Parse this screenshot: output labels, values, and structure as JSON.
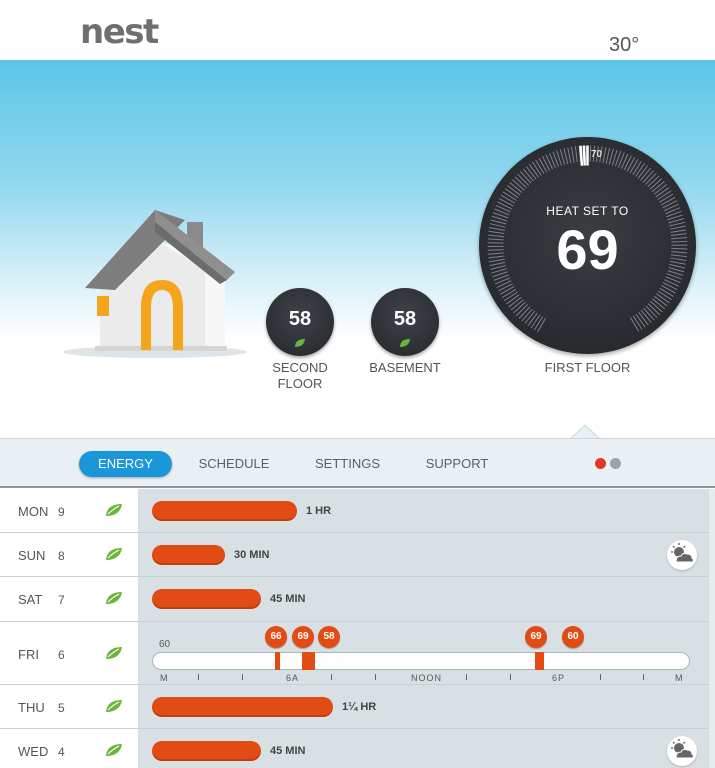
{
  "header": {
    "logo": "nest",
    "outside_temp": "30°"
  },
  "hero": {
    "small_thermostats": [
      {
        "value": "58",
        "label_line1": "SECOND",
        "label_line2": "FLOOR"
      },
      {
        "value": "58",
        "label_line1": "BASEMENT",
        "label_line2": ""
      }
    ],
    "main_thermostat": {
      "mode_label": "HEAT SET TO",
      "value": "69",
      "dial_marker": "70",
      "label": "FIRST FLOOR"
    }
  },
  "nav": {
    "tabs": [
      "ENERGY",
      "SCHEDULE",
      "SETTINGS",
      "SUPPORT"
    ],
    "active_tab": "ENERGY"
  },
  "colors": {
    "accent_blue": "#1a97d8",
    "bar_orange": "#e24b13",
    "leaf_green": "#6ab63c",
    "page_dot_active": "#e03a1e",
    "page_dot_inactive": "#9aa3a8"
  },
  "energy_history": [
    {
      "day": "MON",
      "date": "9",
      "usage": "1 HR",
      "usage_hours": 1.0,
      "weather": false
    },
    {
      "day": "SUN",
      "date": "8",
      "usage": "30 MIN",
      "usage_hours": 0.5,
      "weather": true
    },
    {
      "day": "SAT",
      "date": "7",
      "usage": "45 MIN",
      "usage_hours": 0.75,
      "weather": false
    },
    {
      "day": "FRI",
      "date": "6",
      "expanded": true,
      "start_temp": "60",
      "setpoints": [
        "66",
        "69",
        "58",
        "69",
        "60"
      ],
      "axis_labels": [
        "M",
        "6A",
        "NOON",
        "6P",
        "M"
      ]
    },
    {
      "day": "THU",
      "date": "5",
      "usage": "1¼ HR",
      "usage_hours": 1.25,
      "weather": false
    },
    {
      "day": "WED",
      "date": "4",
      "usage": "45 MIN",
      "usage_hours": 0.75,
      "weather": true
    }
  ],
  "icons": {
    "leaf": "leaf-icon",
    "weather": "partly-cloudy-icon"
  }
}
